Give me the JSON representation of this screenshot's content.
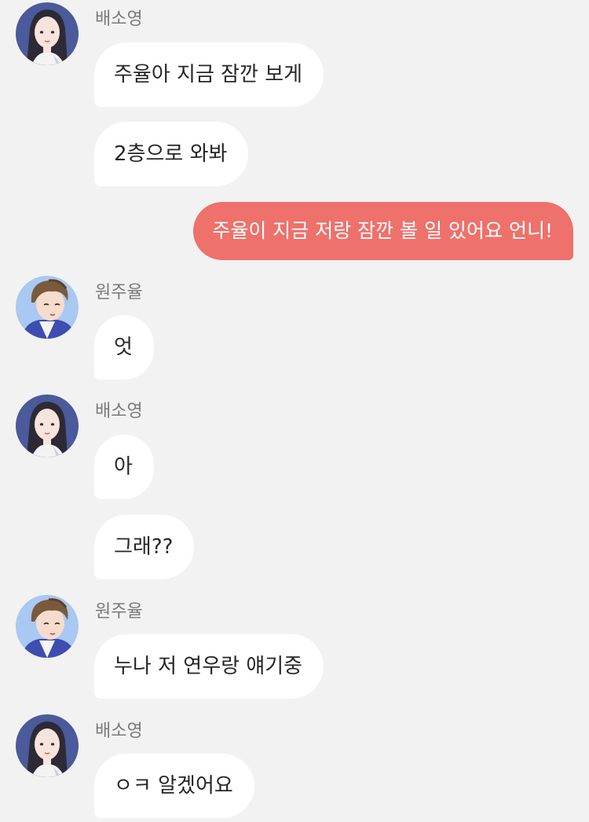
{
  "colors": {
    "background": "#f2f2f2",
    "incoming_bubble": "#ffffff",
    "outgoing_bubble": "#ee716b",
    "sender_name": "#7a7a7a"
  },
  "messages": [
    {
      "sender": "배소영",
      "avatar": "girl-avatar",
      "texts": [
        "주율아 지금 잠깐 보게",
        "2층으로 와봐"
      ]
    },
    {
      "sender": "me",
      "texts": [
        "주율이 지금 저랑 잠깐 볼 일 있어요 언니!"
      ]
    },
    {
      "sender": "원주율",
      "avatar": "boy-avatar",
      "texts": [
        "엇"
      ]
    },
    {
      "sender": "배소영",
      "avatar": "girl-avatar",
      "texts": [
        "아",
        "그래??"
      ]
    },
    {
      "sender": "원주율",
      "avatar": "boy-avatar",
      "texts": [
        "누나 저 연우랑 얘기중"
      ]
    },
    {
      "sender": "배소영",
      "avatar": "girl-avatar",
      "texts": [
        "ㅇㅋ 알겠어요"
      ]
    }
  ]
}
